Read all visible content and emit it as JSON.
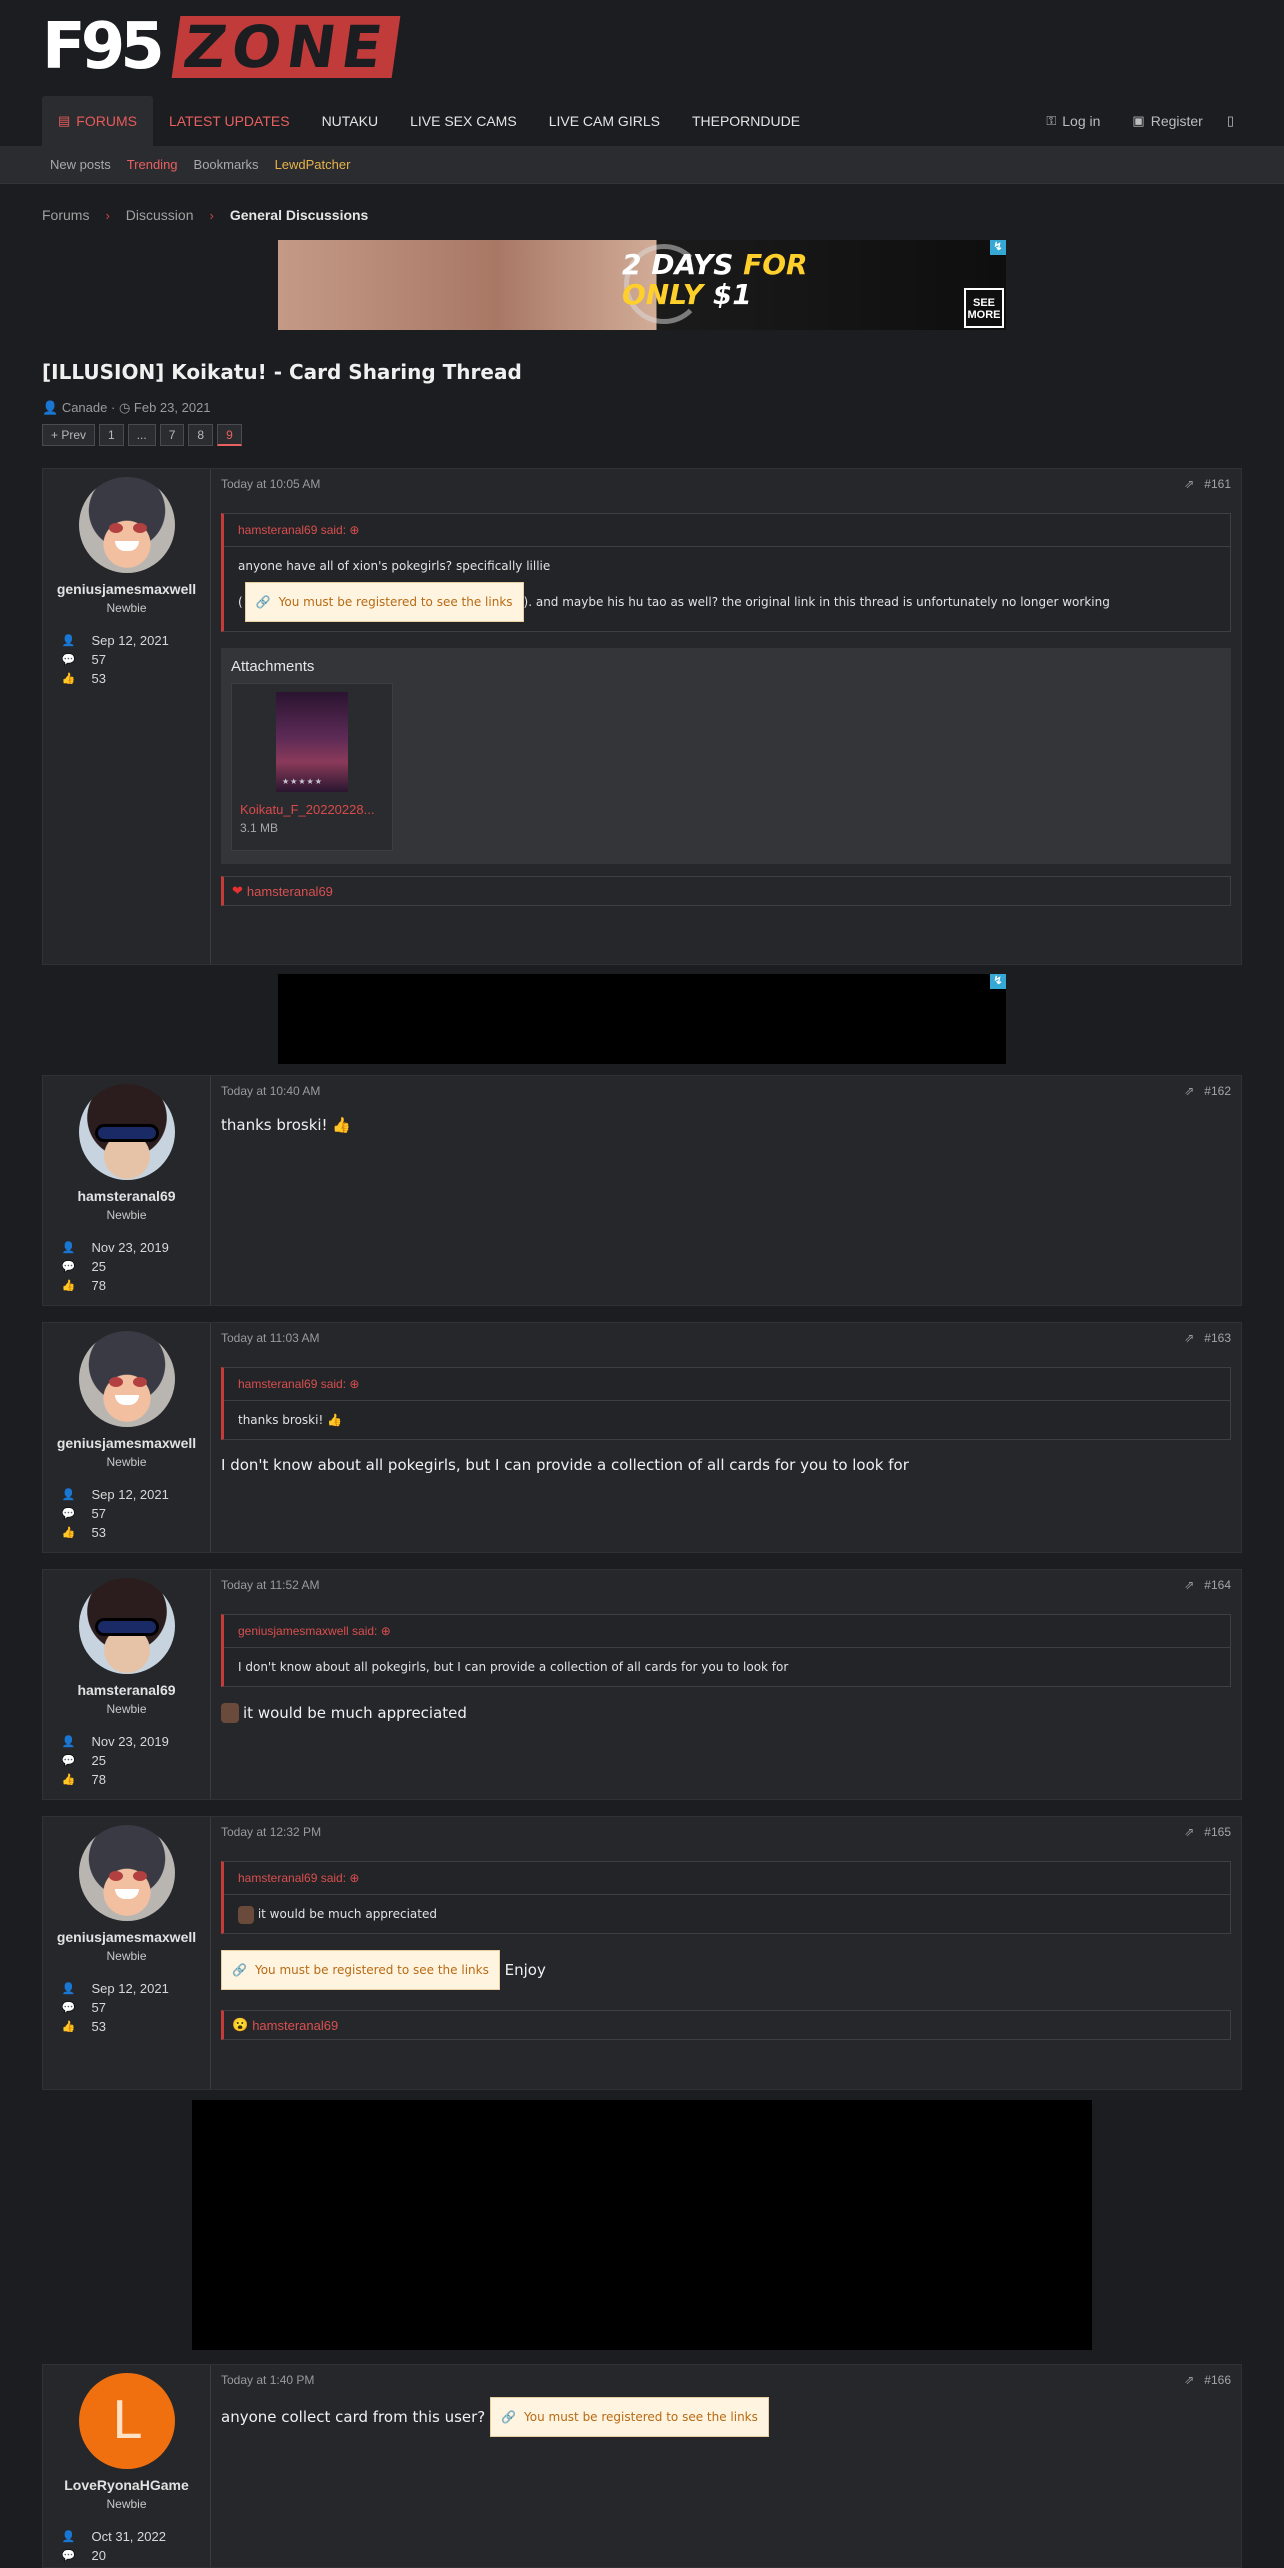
{
  "logo": {
    "part1": "F95",
    "part2": "ZONE"
  },
  "nav": {
    "tabs": [
      {
        "label": "Forums"
      },
      {
        "label": "Latest Updates"
      },
      {
        "label": "NUTAKU"
      },
      {
        "label": "LIVE SEX CAMS"
      },
      {
        "label": "LIVE CAM GIRLS"
      },
      {
        "label": "THEPORNDUDE"
      }
    ],
    "login": "Log in",
    "register": "Register"
  },
  "subnav": [
    "New posts",
    "Trending",
    "Bookmarks",
    "LewdPatcher"
  ],
  "breadcrumb": [
    "Forums",
    "Discussion",
    "General Discussions"
  ],
  "banner": {
    "line1": "2 DAYS",
    "line1b": "FOR",
    "line2a": "ONLY",
    "line2b": "$1",
    "see": "SEE",
    "more": "MORE"
  },
  "thread": {
    "title": "[ILLUSION] Koikatu! - Card Sharing Thread",
    "author": "Canade",
    "date": "Feb 23, 2021",
    "pages": [
      "+ Prev",
      "1",
      "...",
      "7",
      "8",
      "9"
    ]
  },
  "locked_link_text": "You must be registered to see the links",
  "posts": [
    {
      "user": "geniusjamesmaxwell",
      "title": "Newbie",
      "joined": "Sep 12, 2021",
      "messages": "57",
      "reactions": "53",
      "time": "Today at 10:05 AM",
      "num": "#161",
      "quote_author": "hamsteranal69 said:",
      "quote_line1": "anyone have all of xion's pokegirls? specifically lillie",
      "quote_line2_pre": "(",
      "quote_line2_post": "). and maybe his hu tao as well? the original link in this thread is unfortunately no longer working",
      "attachments_title": "Attachments",
      "attachment_name": "Koikatu_F_20220228...",
      "attachment_size": "3.1 MB",
      "reaction_user": "hamsteranal69"
    },
    {
      "user": "hamsteranal69",
      "title": "Newbie",
      "joined": "Nov 23, 2019",
      "messages": "25",
      "reactions": "78",
      "time": "Today at 10:40 AM",
      "num": "#162",
      "text": "thanks broski!",
      "emoji": "👍"
    },
    {
      "user": "geniusjamesmaxwell",
      "title": "Newbie",
      "joined": "Sep 12, 2021",
      "messages": "57",
      "reactions": "53",
      "time": "Today at 11:03 AM",
      "num": "#163",
      "quote_author": "hamsteranal69 said:",
      "quote_text": "thanks broski!",
      "quote_emoji": "👍",
      "text": "I don't know about all pokegirls, but I can provide a collection of all cards for you to look for"
    },
    {
      "user": "hamsteranal69",
      "title": "Newbie",
      "joined": "Nov 23, 2019",
      "messages": "25",
      "reactions": "78",
      "time": "Today at 11:52 AM",
      "num": "#164",
      "quote_author": "geniusjamesmaxwell said:",
      "quote_text": "I don't know about all pokegirls, but I can provide a collection of all cards for you to look for",
      "text": "it would be much appreciated"
    },
    {
      "user": "geniusjamesmaxwell",
      "title": "Newbie",
      "joined": "Sep 12, 2021",
      "messages": "57",
      "reactions": "53",
      "time": "Today at 12:32 PM",
      "num": "#165",
      "quote_author": "hamsteranal69 said:",
      "quote_text": "it would be much appreciated",
      "text": "Enjoy",
      "reaction_emoji": "😮",
      "reaction_user": "hamsteranal69"
    },
    {
      "user": "LoveRyonaHGame",
      "avatar_letter": "L",
      "title": "Newbie",
      "joined": "Oct 31, 2022",
      "messages": "20",
      "time": "Today at 1:40 PM",
      "num": "#166",
      "text": "anyone collect card from this user?"
    }
  ],
  "colors": {
    "accent": "#c53b3b",
    "bg": "#1c1d20",
    "panel": "#26272b",
    "link_box": "#fff4e0"
  },
  "icons": [
    "comments-icon",
    "key-icon",
    "register-icon",
    "search-icon",
    "user-icon",
    "clock-icon",
    "share-icon",
    "heart-icon",
    "link-icon",
    "arrow-up-icon",
    "thumbs-up-icon"
  ]
}
